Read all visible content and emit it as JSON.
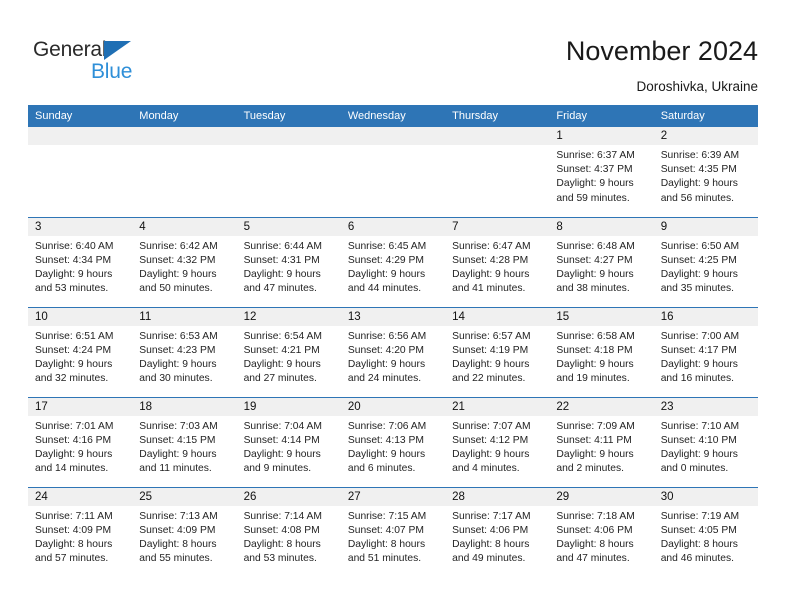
{
  "brand": {
    "name_top": "General",
    "name_bottom": "Blue",
    "triangle_color": "#1f6fb4",
    "blue_text_color": "#2f8fd8"
  },
  "header": {
    "title": "November 2024",
    "location": "Doroshivka, Ukraine"
  },
  "theme": {
    "header_blue": "#2e75b6",
    "daynum_band": "#f0f0f0",
    "text": "#232323"
  },
  "weekdays": [
    "Sunday",
    "Monday",
    "Tuesday",
    "Wednesday",
    "Thursday",
    "Friday",
    "Saturday"
  ],
  "weeks": [
    [
      {
        "day": ""
      },
      {
        "day": ""
      },
      {
        "day": ""
      },
      {
        "day": ""
      },
      {
        "day": ""
      },
      {
        "day": "1",
        "sunrise": "Sunrise: 6:37 AM",
        "sunset": "Sunset: 4:37 PM",
        "daylight1": "Daylight: 9 hours",
        "daylight2": "and 59 minutes."
      },
      {
        "day": "2",
        "sunrise": "Sunrise: 6:39 AM",
        "sunset": "Sunset: 4:35 PM",
        "daylight1": "Daylight: 9 hours",
        "daylight2": "and 56 minutes."
      }
    ],
    [
      {
        "day": "3",
        "sunrise": "Sunrise: 6:40 AM",
        "sunset": "Sunset: 4:34 PM",
        "daylight1": "Daylight: 9 hours",
        "daylight2": "and 53 minutes."
      },
      {
        "day": "4",
        "sunrise": "Sunrise: 6:42 AM",
        "sunset": "Sunset: 4:32 PM",
        "daylight1": "Daylight: 9 hours",
        "daylight2": "and 50 minutes."
      },
      {
        "day": "5",
        "sunrise": "Sunrise: 6:44 AM",
        "sunset": "Sunset: 4:31 PM",
        "daylight1": "Daylight: 9 hours",
        "daylight2": "and 47 minutes."
      },
      {
        "day": "6",
        "sunrise": "Sunrise: 6:45 AM",
        "sunset": "Sunset: 4:29 PM",
        "daylight1": "Daylight: 9 hours",
        "daylight2": "and 44 minutes."
      },
      {
        "day": "7",
        "sunrise": "Sunrise: 6:47 AM",
        "sunset": "Sunset: 4:28 PM",
        "daylight1": "Daylight: 9 hours",
        "daylight2": "and 41 minutes."
      },
      {
        "day": "8",
        "sunrise": "Sunrise: 6:48 AM",
        "sunset": "Sunset: 4:27 PM",
        "daylight1": "Daylight: 9 hours",
        "daylight2": "and 38 minutes."
      },
      {
        "day": "9",
        "sunrise": "Sunrise: 6:50 AM",
        "sunset": "Sunset: 4:25 PM",
        "daylight1": "Daylight: 9 hours",
        "daylight2": "and 35 minutes."
      }
    ],
    [
      {
        "day": "10",
        "sunrise": "Sunrise: 6:51 AM",
        "sunset": "Sunset: 4:24 PM",
        "daylight1": "Daylight: 9 hours",
        "daylight2": "and 32 minutes."
      },
      {
        "day": "11",
        "sunrise": "Sunrise: 6:53 AM",
        "sunset": "Sunset: 4:23 PM",
        "daylight1": "Daylight: 9 hours",
        "daylight2": "and 30 minutes."
      },
      {
        "day": "12",
        "sunrise": "Sunrise: 6:54 AM",
        "sunset": "Sunset: 4:21 PM",
        "daylight1": "Daylight: 9 hours",
        "daylight2": "and 27 minutes."
      },
      {
        "day": "13",
        "sunrise": "Sunrise: 6:56 AM",
        "sunset": "Sunset: 4:20 PM",
        "daylight1": "Daylight: 9 hours",
        "daylight2": "and 24 minutes."
      },
      {
        "day": "14",
        "sunrise": "Sunrise: 6:57 AM",
        "sunset": "Sunset: 4:19 PM",
        "daylight1": "Daylight: 9 hours",
        "daylight2": "and 22 minutes."
      },
      {
        "day": "15",
        "sunrise": "Sunrise: 6:58 AM",
        "sunset": "Sunset: 4:18 PM",
        "daylight1": "Daylight: 9 hours",
        "daylight2": "and 19 minutes."
      },
      {
        "day": "16",
        "sunrise": "Sunrise: 7:00 AM",
        "sunset": "Sunset: 4:17 PM",
        "daylight1": "Daylight: 9 hours",
        "daylight2": "and 16 minutes."
      }
    ],
    [
      {
        "day": "17",
        "sunrise": "Sunrise: 7:01 AM",
        "sunset": "Sunset: 4:16 PM",
        "daylight1": "Daylight: 9 hours",
        "daylight2": "and 14 minutes."
      },
      {
        "day": "18",
        "sunrise": "Sunrise: 7:03 AM",
        "sunset": "Sunset: 4:15 PM",
        "daylight1": "Daylight: 9 hours",
        "daylight2": "and 11 minutes."
      },
      {
        "day": "19",
        "sunrise": "Sunrise: 7:04 AM",
        "sunset": "Sunset: 4:14 PM",
        "daylight1": "Daylight: 9 hours",
        "daylight2": "and 9 minutes."
      },
      {
        "day": "20",
        "sunrise": "Sunrise: 7:06 AM",
        "sunset": "Sunset: 4:13 PM",
        "daylight1": "Daylight: 9 hours",
        "daylight2": "and 6 minutes."
      },
      {
        "day": "21",
        "sunrise": "Sunrise: 7:07 AM",
        "sunset": "Sunset: 4:12 PM",
        "daylight1": "Daylight: 9 hours",
        "daylight2": "and 4 minutes."
      },
      {
        "day": "22",
        "sunrise": "Sunrise: 7:09 AM",
        "sunset": "Sunset: 4:11 PM",
        "daylight1": "Daylight: 9 hours",
        "daylight2": "and 2 minutes."
      },
      {
        "day": "23",
        "sunrise": "Sunrise: 7:10 AM",
        "sunset": "Sunset: 4:10 PM",
        "daylight1": "Daylight: 9 hours",
        "daylight2": "and 0 minutes."
      }
    ],
    [
      {
        "day": "24",
        "sunrise": "Sunrise: 7:11 AM",
        "sunset": "Sunset: 4:09 PM",
        "daylight1": "Daylight: 8 hours",
        "daylight2": "and 57 minutes."
      },
      {
        "day": "25",
        "sunrise": "Sunrise: 7:13 AM",
        "sunset": "Sunset: 4:09 PM",
        "daylight1": "Daylight: 8 hours",
        "daylight2": "and 55 minutes."
      },
      {
        "day": "26",
        "sunrise": "Sunrise: 7:14 AM",
        "sunset": "Sunset: 4:08 PM",
        "daylight1": "Daylight: 8 hours",
        "daylight2": "and 53 minutes."
      },
      {
        "day": "27",
        "sunrise": "Sunrise: 7:15 AM",
        "sunset": "Sunset: 4:07 PM",
        "daylight1": "Daylight: 8 hours",
        "daylight2": "and 51 minutes."
      },
      {
        "day": "28",
        "sunrise": "Sunrise: 7:17 AM",
        "sunset": "Sunset: 4:06 PM",
        "daylight1": "Daylight: 8 hours",
        "daylight2": "and 49 minutes."
      },
      {
        "day": "29",
        "sunrise": "Sunrise: 7:18 AM",
        "sunset": "Sunset: 4:06 PM",
        "daylight1": "Daylight: 8 hours",
        "daylight2": "and 47 minutes."
      },
      {
        "day": "30",
        "sunrise": "Sunrise: 7:19 AM",
        "sunset": "Sunset: 4:05 PM",
        "daylight1": "Daylight: 8 hours",
        "daylight2": "and 46 minutes."
      }
    ]
  ]
}
